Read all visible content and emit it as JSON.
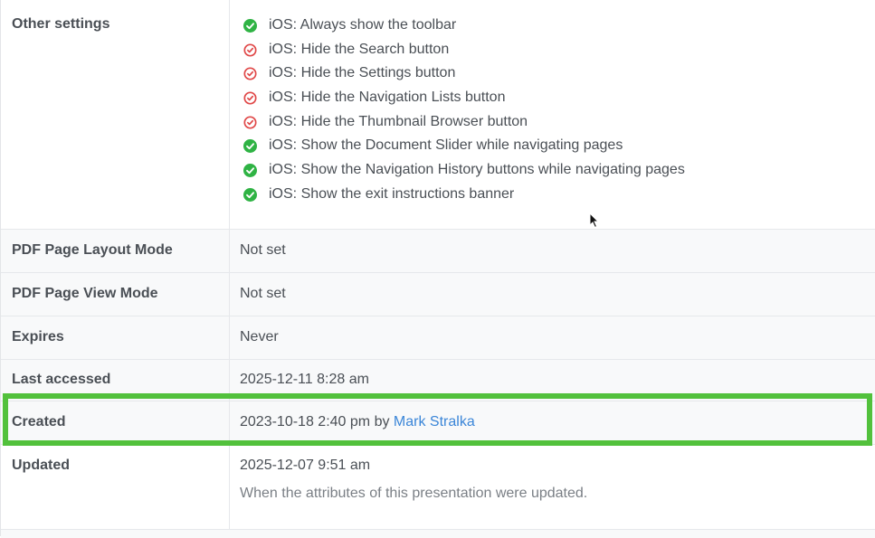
{
  "other_settings": {
    "label": "Other settings",
    "items": [
      {
        "label": "iOS: Always show the toolbar",
        "status": "enabled"
      },
      {
        "label": "iOS: Hide the Search button",
        "status": "disabled"
      },
      {
        "label": "iOS: Hide the Settings button",
        "status": "disabled"
      },
      {
        "label": "iOS: Hide the Navigation Lists button",
        "status": "disabled"
      },
      {
        "label": "iOS: Hide the Thumbnail Browser button",
        "status": "disabled"
      },
      {
        "label": "iOS: Show the Document Slider while navigating pages",
        "status": "enabled"
      },
      {
        "label": "iOS: Show the Navigation History buttons while navigating pages",
        "status": "enabled"
      },
      {
        "label": "iOS: Show the exit instructions banner",
        "status": "enabled"
      }
    ]
  },
  "rows": {
    "pdf_layout_mode": {
      "label": "PDF Page Layout Mode",
      "value": "Not set"
    },
    "pdf_view_mode": {
      "label": "PDF Page View Mode",
      "value": "Not set"
    },
    "expires": {
      "label": "Expires",
      "value": "Never"
    },
    "last_accessed": {
      "label": "Last accessed",
      "value": "2025-12-11 8:28 am"
    },
    "created": {
      "label": "Created",
      "value": "2023-10-18 2:40 pm",
      "by_text": "by",
      "author": "Mark Stralka"
    },
    "updated": {
      "label": "Updated",
      "value": "2025-12-07 9:51 am",
      "note": "When the attributes of this presentation were updated."
    }
  },
  "colors": {
    "enabled_icon": "#2fb344",
    "disabled_icon": "#e04848",
    "highlight": "#52c13c",
    "link": "#3b86d8"
  },
  "icons": {
    "enabled": "check-circle-icon",
    "disabled": "x-circle-icon"
  }
}
